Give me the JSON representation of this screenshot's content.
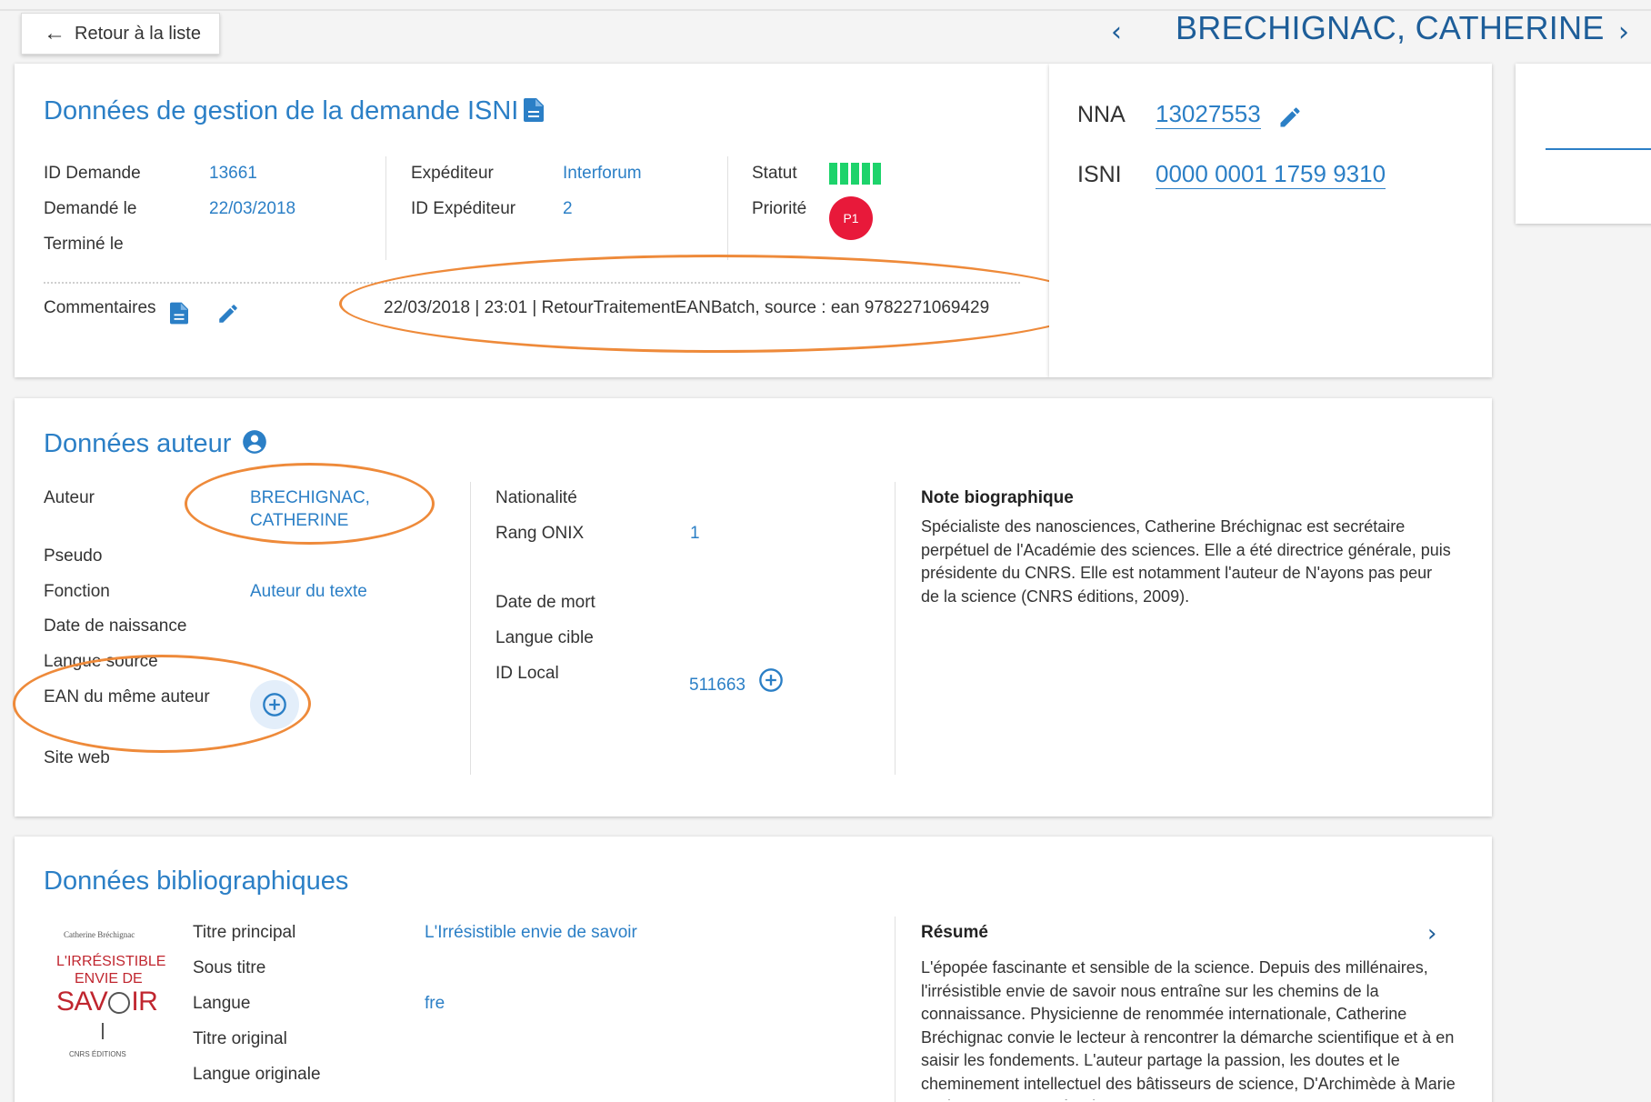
{
  "header": {
    "back_label": "Retour à la liste",
    "title": "BRECHIGNAC, CATHERINE",
    "prev_symbol": "‹",
    "next_symbol": "›"
  },
  "gestion": {
    "title": "Données de gestion de la demande ISNI",
    "id_demande_label": "ID Demande",
    "id_demande": "13661",
    "demande_le_label": "Demandé le",
    "demande_le": "22/03/2018",
    "termine_le_label": "Terminé le",
    "expediteur_label": "Expéditeur",
    "expediteur": "Interforum",
    "id_expediteur_label": "ID Expéditeur",
    "id_expediteur": "2",
    "statut_label": "Statut",
    "statut_level": 5,
    "priorite_label": "Priorité",
    "priorite": "P1",
    "commentaires_label": "Commentaires",
    "commentaire": "22/03/2018 | 23:01 | RetourTraitementEANBatch, source : ean 9782271069429"
  },
  "ids": {
    "nna_label": "NNA",
    "nna": "13027553",
    "isni_label": "ISNI",
    "isni": "0000 0001 1759 9310"
  },
  "auteur": {
    "title": "Données auteur",
    "auteur_label": "Auteur",
    "auteur_line1": "BRECHIGNAC,",
    "auteur_line2": "CATHERINE",
    "pseudo_label": "Pseudo",
    "fonction_label": "Fonction",
    "fonction": "Auteur du texte",
    "naissance_label": "Date de naissance",
    "langue_source_label": "Langue source",
    "ean_label": "EAN du même auteur",
    "site_web_label": "Site web",
    "nationalite_label": "Nationalité",
    "rang_onix_label": "Rang ONIX",
    "rang_onix": "1",
    "date_mort_label": "Date de mort",
    "langue_cible_label": "Langue cible",
    "id_local_label": "ID Local",
    "id_local": "511663",
    "note_title": "Note biographique",
    "note_text": "Spécialiste des nanosciences, Catherine Bréchignac est secrétaire perpétuel de l'Académie des sciences. Elle a été directrice générale, puis présidente du CNRS. Elle est notamment l'auteur de N'ayons pas peur de la science (CNRS éditions, 2009)."
  },
  "biblio": {
    "title": "Données bibliographiques",
    "titre_principal_label": "Titre principal",
    "titre_principal": "L'Irrésistible envie de savoir",
    "sous_titre_label": "Sous titre",
    "langue_label": "Langue",
    "langue": "fre",
    "titre_original_label": "Titre original",
    "langue_originale_label": "Langue originale",
    "resume_title": "Résumé",
    "resume_text": "L'épopée fascinante et sensible de la science. Depuis des millénaires, l'irrésistible envie de savoir nous entraîne sur les chemins de la connaissance. Physicienne de renommée internationale, Catherine Bréchignac convie le lecteur à rencontrer la démarche scientifique et à en saisir les fondements. L'auteur partage la passion, les doutes et le cheminement intellectuel des bâtisseurs de science, D'Archimède à Marie Curie, en tant que témoin"
  },
  "cover": {
    "author": "Catherine Bréchignac",
    "line1": "L'IRRÉSISTIBLE",
    "line2": "ENVIE DE",
    "line3_a": "SAV",
    "line3_b": "IR",
    "publisher": "CNRS ÉDITIONS"
  },
  "colors": {
    "accent": "#2b7fc6",
    "header_blue": "#1e5e99",
    "status_green": "#1dd36b",
    "priority_red": "#e8193a",
    "annotation_orange": "#ee8a3a"
  },
  "icons": [
    "arrow-left-icon",
    "chevron-left-icon",
    "chevron-right-icon",
    "document-icon",
    "pencil-icon",
    "user-circle-icon",
    "plus-circle-icon"
  ]
}
